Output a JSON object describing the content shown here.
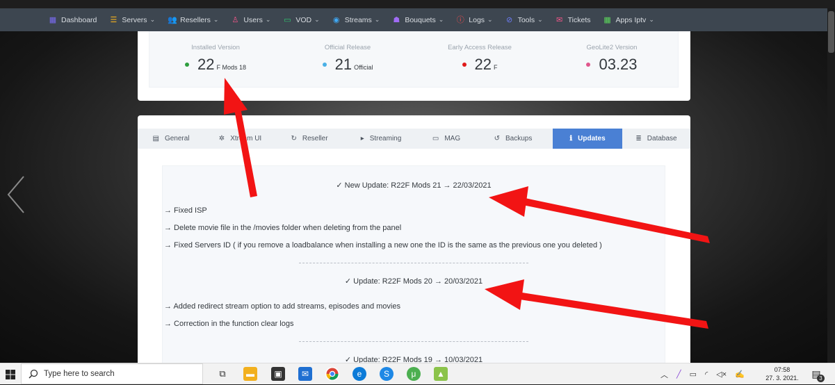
{
  "nav": {
    "items": [
      {
        "label": "Dashboard",
        "icon": "dashboard-icon",
        "color": "#7b6cf5",
        "chev": false
      },
      {
        "label": "Servers",
        "icon": "servers-icon",
        "color": "#f2b01e",
        "chev": true
      },
      {
        "label": "Resellers",
        "icon": "resellers-icon",
        "color": "#5b8cf5",
        "chev": true
      },
      {
        "label": "Users",
        "icon": "users-icon",
        "color": "#f2578a",
        "chev": true
      },
      {
        "label": "VOD",
        "icon": "vod-icon",
        "color": "#2ecc71",
        "chev": true
      },
      {
        "label": "Streams",
        "icon": "streams-icon",
        "color": "#3fa9f5",
        "chev": true
      },
      {
        "label": "Bouquets",
        "icon": "bouquets-icon",
        "color": "#a06cf5",
        "chev": true
      },
      {
        "label": "Logs",
        "icon": "logs-icon",
        "color": "#ff4d4d",
        "chev": true
      },
      {
        "label": "Tools",
        "icon": "tools-icon",
        "color": "#6c7cf5",
        "chev": true
      },
      {
        "label": "Tickets",
        "icon": "tickets-icon",
        "color": "#f2578a",
        "chev": false
      },
      {
        "label": "Apps Iptv",
        "icon": "apps-icon",
        "color": "#5cd65c",
        "chev": true
      }
    ]
  },
  "stats": [
    {
      "label": "Installed Version",
      "value": "22",
      "suffix": "F Mods 18",
      "dot": "#2e9e3e"
    },
    {
      "label": "Official Release",
      "value": "21",
      "suffix": "Official",
      "dot": "#4ab0e6"
    },
    {
      "label": "Early Access Release",
      "value": "22",
      "suffix": "F",
      "dot": "#e01a1a"
    },
    {
      "label": "GeoLite2 Version",
      "value": "03.23",
      "suffix": "",
      "dot": "#e0568c"
    }
  ],
  "tabs": [
    {
      "label": "General",
      "icon": "▤",
      "active": false
    },
    {
      "label": "Xtream UI",
      "icon": "✲",
      "active": false
    },
    {
      "label": "Reseller",
      "icon": "↻",
      "active": false
    },
    {
      "label": "Streaming",
      "icon": "▸",
      "active": false
    },
    {
      "label": "MAG",
      "icon": "▭",
      "active": false
    },
    {
      "label": "Backups",
      "icon": "↺",
      "active": false
    },
    {
      "label": "Updates",
      "icon": "ℹ",
      "active": true
    },
    {
      "label": "Database",
      "icon": "≣",
      "active": false
    }
  ],
  "updates": {
    "u1_title": "✓ New Update: R22F Mods 21 → 22/03/2021",
    "u1_items": [
      "→ Fixed ISP",
      "→ Delete movie file in the /movies folder when deleting from the panel",
      "→ Fixed Servers ID ( if you remove a loadbalance when installing a new one the ID is the same as the previous one you deleted )"
    ],
    "u2_title": "✓ Update: R22F Mods 20 → 20/03/2021",
    "u2_items": [
      "→ Added redirect stream option to add streams, episodes and movies",
      "→ Correction in the function clear logs"
    ],
    "u3_title": "✓ Update: R22F Mods 19 → 10/03/2021"
  },
  "taskbar": {
    "search_placeholder": "Type here to search",
    "time": "07:58",
    "date": "27. 3. 2021.",
    "notification_count": "3"
  }
}
